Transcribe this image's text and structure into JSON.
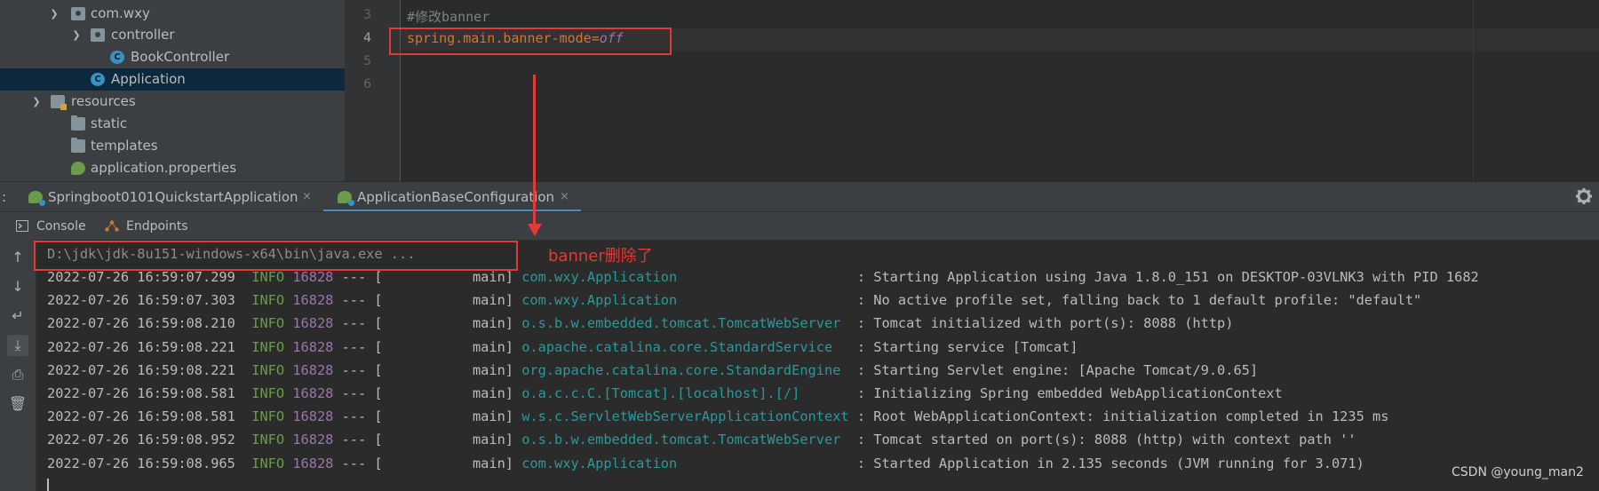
{
  "project_tree": {
    "items": [
      {
        "label": "com.wxy",
        "icon": "package-icon"
      },
      {
        "label": "controller",
        "icon": "package-icon"
      },
      {
        "label": "BookController",
        "icon": "class-icon"
      },
      {
        "label": "Application",
        "icon": "spring-class-icon"
      },
      {
        "label": "resources",
        "icon": "resources-folder-icon"
      },
      {
        "label": "static",
        "icon": "folder-icon"
      },
      {
        "label": "templates",
        "icon": "folder-icon"
      },
      {
        "label": "application.properties",
        "icon": "spring-properties-icon"
      }
    ]
  },
  "editor": {
    "line_numbers": [
      "3",
      "4",
      "5",
      "6"
    ],
    "comment": "#修改banner",
    "property_key": "spring.main.banner-mode",
    "property_eq": "=",
    "property_value": "off"
  },
  "run_tabs": [
    {
      "label": "Springboot0101QuickstartApplication",
      "close": "×",
      "active": false
    },
    {
      "label": "ApplicationBaseConfiguration",
      "close": "×",
      "active": true
    }
  ],
  "run_tabs_prefix": ":",
  "console_bar": {
    "console_label": "Console",
    "endpoints_label": "Endpoints"
  },
  "console": {
    "command": "D:\\jdk\\jdk-8u151-windows-x64\\bin\\java.exe ...",
    "log_lines": [
      {
        "ts": "2022-07-26 16:59:07.299",
        "level": "INFO",
        "pid": "16828",
        "sep": "--- [           main]",
        "logger": "com.wxy.Application                      ",
        "msg": ": Starting Application using Java 1.8.0_151 on DESKTOP-03VLNK3 with PID 1682"
      },
      {
        "ts": "2022-07-26 16:59:07.303",
        "level": "INFO",
        "pid": "16828",
        "sep": "--- [           main]",
        "logger": "com.wxy.Application                      ",
        "msg": ": No active profile set, falling back to 1 default profile: \"default\""
      },
      {
        "ts": "2022-07-26 16:59:08.210",
        "level": "INFO",
        "pid": "16828",
        "sep": "--- [           main]",
        "logger": "o.s.b.w.embedded.tomcat.TomcatWebServer  ",
        "msg": ": Tomcat initialized with port(s): 8088 (http)"
      },
      {
        "ts": "2022-07-26 16:59:08.221",
        "level": "INFO",
        "pid": "16828",
        "sep": "--- [           main]",
        "logger": "o.apache.catalina.core.StandardService   ",
        "msg": ": Starting service [Tomcat]"
      },
      {
        "ts": "2022-07-26 16:59:08.221",
        "level": "INFO",
        "pid": "16828",
        "sep": "--- [           main]",
        "logger": "org.apache.catalina.core.StandardEngine  ",
        "msg": ": Starting Servlet engine: [Apache Tomcat/9.0.65]"
      },
      {
        "ts": "2022-07-26 16:59:08.581",
        "level": "INFO",
        "pid": "16828",
        "sep": "--- [           main]",
        "logger": "o.a.c.c.C.[Tomcat].[localhost].[/]       ",
        "msg": ": Initializing Spring embedded WebApplicationContext"
      },
      {
        "ts": "2022-07-26 16:59:08.581",
        "level": "INFO",
        "pid": "16828",
        "sep": "--- [           main]",
        "logger": "w.s.c.ServletWebServerApplicationContext ",
        "msg": ": Root WebApplicationContext: initialization completed in 1235 ms"
      },
      {
        "ts": "2022-07-26 16:59:08.952",
        "level": "INFO",
        "pid": "16828",
        "sep": "--- [           main]",
        "logger": "o.s.b.w.embedded.tomcat.TomcatWebServer  ",
        "msg": ": Tomcat started on port(s): 8088 (http) with context path ''"
      },
      {
        "ts": "2022-07-26 16:59:08.965",
        "level": "INFO",
        "pid": "16828",
        "sep": "--- [           main]",
        "logger": "com.wxy.Application                      ",
        "msg": ": Started Application in 2.135 seconds (JVM running for 3.071)"
      }
    ]
  },
  "annotation": {
    "note": "banner删除了",
    "color": "#e53935"
  },
  "watermark": "CSDN @young_man2",
  "colors": {
    "accent": "#4a88c7",
    "info": "#6a9a4c",
    "pid": "#9876aa",
    "logger": "#299999",
    "key": "#cc7832"
  }
}
